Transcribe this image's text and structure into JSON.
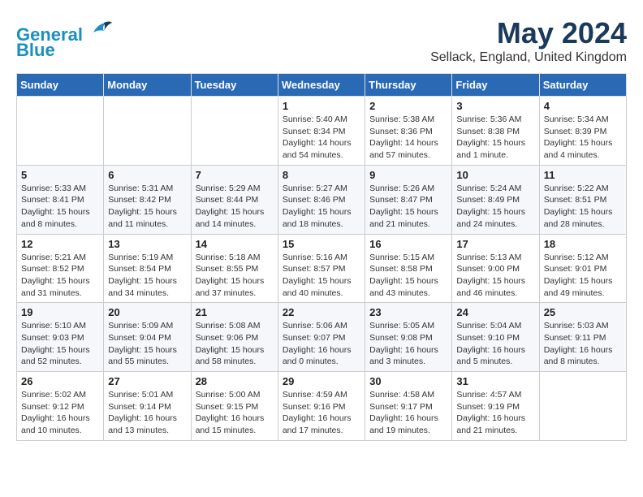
{
  "header": {
    "logo_line1": "General",
    "logo_line2": "Blue",
    "month_year": "May 2024",
    "location": "Sellack, England, United Kingdom"
  },
  "weekdays": [
    "Sunday",
    "Monday",
    "Tuesday",
    "Wednesday",
    "Thursday",
    "Friday",
    "Saturday"
  ],
  "weeks": [
    [
      {
        "day": "",
        "info": ""
      },
      {
        "day": "",
        "info": ""
      },
      {
        "day": "",
        "info": ""
      },
      {
        "day": "1",
        "info": "Sunrise: 5:40 AM\nSunset: 8:34 PM\nDaylight: 14 hours\nand 54 minutes."
      },
      {
        "day": "2",
        "info": "Sunrise: 5:38 AM\nSunset: 8:36 PM\nDaylight: 14 hours\nand 57 minutes."
      },
      {
        "day": "3",
        "info": "Sunrise: 5:36 AM\nSunset: 8:38 PM\nDaylight: 15 hours\nand 1 minute."
      },
      {
        "day": "4",
        "info": "Sunrise: 5:34 AM\nSunset: 8:39 PM\nDaylight: 15 hours\nand 4 minutes."
      }
    ],
    [
      {
        "day": "5",
        "info": "Sunrise: 5:33 AM\nSunset: 8:41 PM\nDaylight: 15 hours\nand 8 minutes."
      },
      {
        "day": "6",
        "info": "Sunrise: 5:31 AM\nSunset: 8:42 PM\nDaylight: 15 hours\nand 11 minutes."
      },
      {
        "day": "7",
        "info": "Sunrise: 5:29 AM\nSunset: 8:44 PM\nDaylight: 15 hours\nand 14 minutes."
      },
      {
        "day": "8",
        "info": "Sunrise: 5:27 AM\nSunset: 8:46 PM\nDaylight: 15 hours\nand 18 minutes."
      },
      {
        "day": "9",
        "info": "Sunrise: 5:26 AM\nSunset: 8:47 PM\nDaylight: 15 hours\nand 21 minutes."
      },
      {
        "day": "10",
        "info": "Sunrise: 5:24 AM\nSunset: 8:49 PM\nDaylight: 15 hours\nand 24 minutes."
      },
      {
        "day": "11",
        "info": "Sunrise: 5:22 AM\nSunset: 8:51 PM\nDaylight: 15 hours\nand 28 minutes."
      }
    ],
    [
      {
        "day": "12",
        "info": "Sunrise: 5:21 AM\nSunset: 8:52 PM\nDaylight: 15 hours\nand 31 minutes."
      },
      {
        "day": "13",
        "info": "Sunrise: 5:19 AM\nSunset: 8:54 PM\nDaylight: 15 hours\nand 34 minutes."
      },
      {
        "day": "14",
        "info": "Sunrise: 5:18 AM\nSunset: 8:55 PM\nDaylight: 15 hours\nand 37 minutes."
      },
      {
        "day": "15",
        "info": "Sunrise: 5:16 AM\nSunset: 8:57 PM\nDaylight: 15 hours\nand 40 minutes."
      },
      {
        "day": "16",
        "info": "Sunrise: 5:15 AM\nSunset: 8:58 PM\nDaylight: 15 hours\nand 43 minutes."
      },
      {
        "day": "17",
        "info": "Sunrise: 5:13 AM\nSunset: 9:00 PM\nDaylight: 15 hours\nand 46 minutes."
      },
      {
        "day": "18",
        "info": "Sunrise: 5:12 AM\nSunset: 9:01 PM\nDaylight: 15 hours\nand 49 minutes."
      }
    ],
    [
      {
        "day": "19",
        "info": "Sunrise: 5:10 AM\nSunset: 9:03 PM\nDaylight: 15 hours\nand 52 minutes."
      },
      {
        "day": "20",
        "info": "Sunrise: 5:09 AM\nSunset: 9:04 PM\nDaylight: 15 hours\nand 55 minutes."
      },
      {
        "day": "21",
        "info": "Sunrise: 5:08 AM\nSunset: 9:06 PM\nDaylight: 15 hours\nand 58 minutes."
      },
      {
        "day": "22",
        "info": "Sunrise: 5:06 AM\nSunset: 9:07 PM\nDaylight: 16 hours\nand 0 minutes."
      },
      {
        "day": "23",
        "info": "Sunrise: 5:05 AM\nSunset: 9:08 PM\nDaylight: 16 hours\nand 3 minutes."
      },
      {
        "day": "24",
        "info": "Sunrise: 5:04 AM\nSunset: 9:10 PM\nDaylight: 16 hours\nand 5 minutes."
      },
      {
        "day": "25",
        "info": "Sunrise: 5:03 AM\nSunset: 9:11 PM\nDaylight: 16 hours\nand 8 minutes."
      }
    ],
    [
      {
        "day": "26",
        "info": "Sunrise: 5:02 AM\nSunset: 9:12 PM\nDaylight: 16 hours\nand 10 minutes."
      },
      {
        "day": "27",
        "info": "Sunrise: 5:01 AM\nSunset: 9:14 PM\nDaylight: 16 hours\nand 13 minutes."
      },
      {
        "day": "28",
        "info": "Sunrise: 5:00 AM\nSunset: 9:15 PM\nDaylight: 16 hours\nand 15 minutes."
      },
      {
        "day": "29",
        "info": "Sunrise: 4:59 AM\nSunset: 9:16 PM\nDaylight: 16 hours\nand 17 minutes."
      },
      {
        "day": "30",
        "info": "Sunrise: 4:58 AM\nSunset: 9:17 PM\nDaylight: 16 hours\nand 19 minutes."
      },
      {
        "day": "31",
        "info": "Sunrise: 4:57 AM\nSunset: 9:19 PM\nDaylight: 16 hours\nand 21 minutes."
      },
      {
        "day": "",
        "info": ""
      }
    ]
  ]
}
